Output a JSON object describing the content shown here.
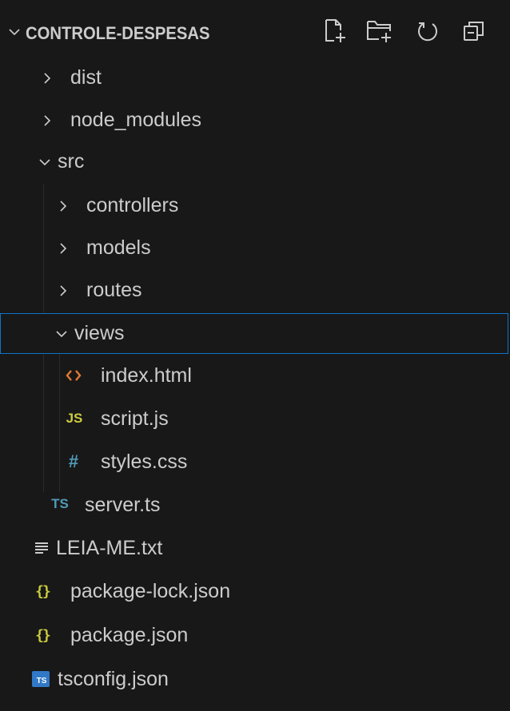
{
  "explorer": {
    "title": "CONTROLE-DESPESAS",
    "actions": [
      {
        "name": "new-file-icon",
        "label": "New File"
      },
      {
        "name": "new-folder-icon",
        "label": "New Folder"
      },
      {
        "name": "refresh-icon",
        "label": "Refresh Explorer"
      },
      {
        "name": "collapse-all-icon",
        "label": "Collapse Folders in Explorer"
      }
    ],
    "items": [
      {
        "label": "dist",
        "kind": "folder",
        "expanded": false
      },
      {
        "label": "node_modules",
        "kind": "folder",
        "expanded": false
      },
      {
        "label": "src",
        "kind": "folder",
        "expanded": true
      },
      {
        "label": "controllers",
        "kind": "folder",
        "expanded": false
      },
      {
        "label": "models",
        "kind": "folder",
        "expanded": false
      },
      {
        "label": "routes",
        "kind": "folder",
        "expanded": false
      },
      {
        "label": "views",
        "kind": "folder",
        "expanded": true,
        "selected": true
      },
      {
        "label": "index.html",
        "kind": "file",
        "icon": "html-icon",
        "icon_text": "<>",
        "icon_color": "#e37933"
      },
      {
        "label": "script.js",
        "kind": "file",
        "icon": "js-icon",
        "icon_text": "JS",
        "icon_color": "#cbcb41"
      },
      {
        "label": "styles.css",
        "kind": "file",
        "icon": "css-icon",
        "icon_text": "#",
        "icon_color": "#519aba"
      },
      {
        "label": "server.ts",
        "kind": "file",
        "icon": "ts-icon",
        "icon_text": "TS",
        "icon_color": "#519aba"
      },
      {
        "label": "LEIA-ME.txt",
        "kind": "file",
        "icon": "text-file-icon",
        "icon_text": "≡",
        "icon_color": "#cccccc"
      },
      {
        "label": "package-lock.json",
        "kind": "file",
        "icon": "json-icon",
        "icon_text": "{}",
        "icon_color": "#cbcb41"
      },
      {
        "label": "package.json",
        "kind": "file",
        "icon": "json-icon",
        "icon_text": "{}",
        "icon_color": "#cbcb41"
      },
      {
        "label": "tsconfig.json",
        "kind": "file",
        "icon": "tsconfig-icon",
        "icon_text": "TS",
        "icon_color": "#3178c6"
      }
    ]
  },
  "colors": {
    "background": "#181818",
    "text": "#cccccc",
    "selection_border": "#0e74c8"
  }
}
